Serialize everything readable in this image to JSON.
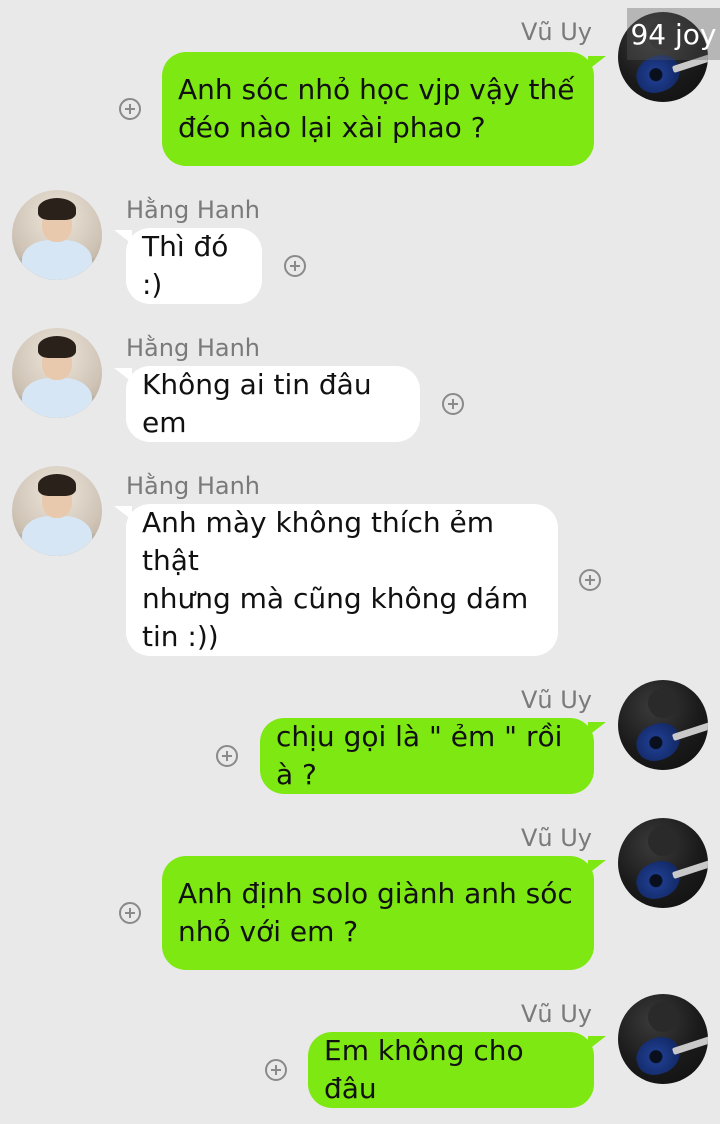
{
  "watermark": "94 joy",
  "messages": [
    {
      "sender": "Vũ Uy",
      "text": "Anh sóc nhỏ học vjp vậy thế\nđéo nào lại xài phao ?",
      "direction": "outgoing"
    },
    {
      "sender": "Hằng Hanh",
      "text": "Thì đó :)",
      "direction": "incoming"
    },
    {
      "sender": "Hằng Hanh",
      "text": "Không ai tin đâu em",
      "direction": "incoming"
    },
    {
      "sender": "Hằng Hanh",
      "text": "Anh mày không thích ẻm thật\nnhưng mà cũng không dám\ntin :))",
      "direction": "incoming"
    },
    {
      "sender": "Vũ Uy",
      "text": "chịu gọi là \" ẻm \" rồi à ?",
      "direction": "outgoing"
    },
    {
      "sender": "Vũ Uy",
      "text": "Anh định solo giành anh sóc\nnhỏ với em ?",
      "direction": "outgoing"
    },
    {
      "sender": "Vũ Uy",
      "text": "Em không cho đâu",
      "direction": "outgoing"
    }
  ],
  "colors": {
    "outgoing_bubble": "#7ee812",
    "incoming_bubble": "#ffffff",
    "background": "#e9e9e9"
  },
  "icons": {
    "add": "plus-circle-icon",
    "outgoing_avatar": "guitar-avatar",
    "incoming_avatar": "boy-avatar"
  }
}
